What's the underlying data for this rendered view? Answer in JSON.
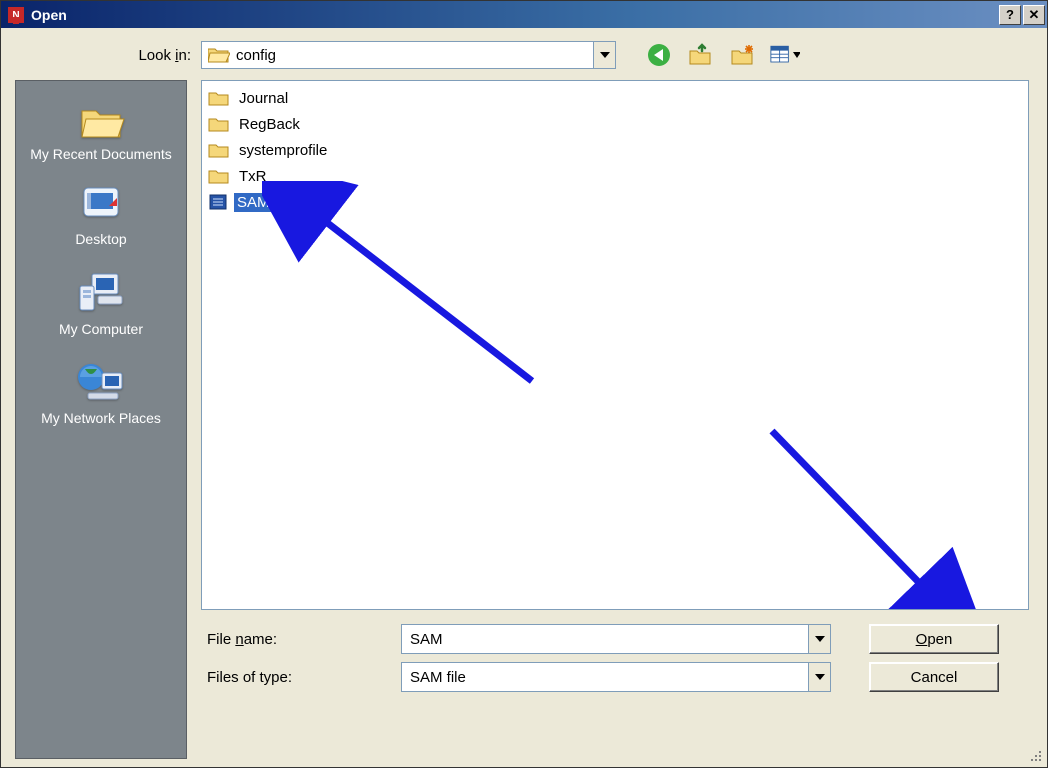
{
  "titlebar": {
    "title": "Open"
  },
  "lookin": {
    "label_pre": "Look ",
    "label_u": "i",
    "label_post": "n:",
    "value": "config"
  },
  "nav": {
    "back": "back-icon",
    "up": "up-one-level-icon",
    "newfolder": "new-folder-icon",
    "views": "views-icon"
  },
  "places": {
    "items": [
      {
        "label": "My Recent Documents"
      },
      {
        "label": "Desktop"
      },
      {
        "label": "My Computer"
      },
      {
        "label": "My Network Places"
      }
    ]
  },
  "files": {
    "items": [
      {
        "name": "Journal",
        "type": "folder",
        "selected": false
      },
      {
        "name": "RegBack",
        "type": "folder",
        "selected": false
      },
      {
        "name": "systemprofile",
        "type": "folder",
        "selected": false
      },
      {
        "name": "TxR",
        "type": "folder",
        "selected": false
      },
      {
        "name": "SAM",
        "type": "file",
        "selected": true
      }
    ]
  },
  "bottom": {
    "file_name_label_pre": "File ",
    "file_name_label_u": "n",
    "file_name_label_post": "ame:",
    "file_name_value": "SAM",
    "file_type_label": "Files of type:",
    "file_type_value": "SAM file",
    "open_u": "O",
    "open_post": "pen",
    "cancel": "Cancel"
  }
}
